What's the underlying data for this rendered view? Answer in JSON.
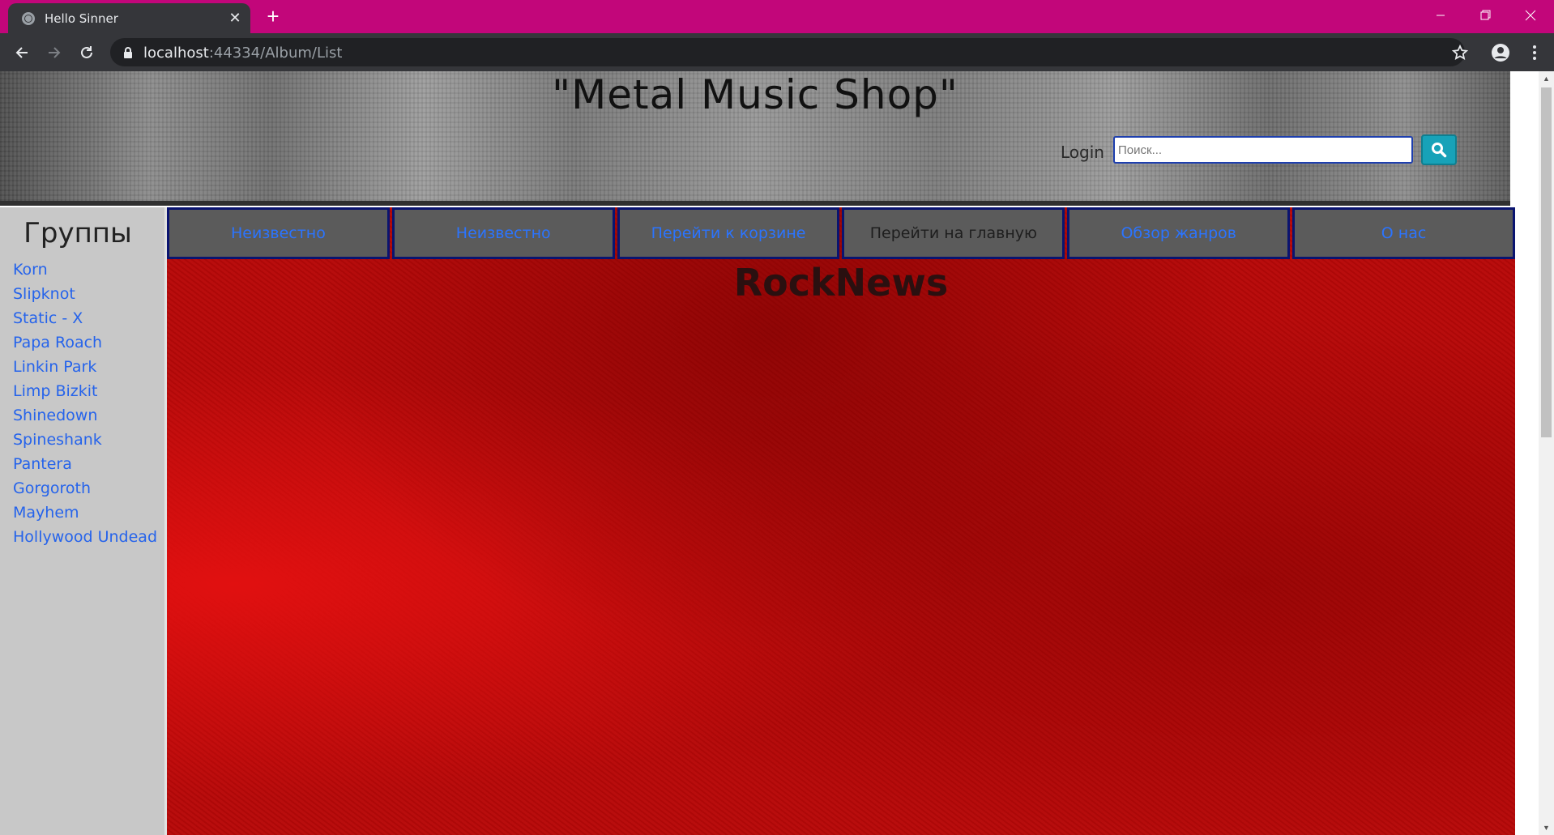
{
  "browser": {
    "accent_color": "#c2067a",
    "tab": {
      "title": "Hello Sinner",
      "favicon": "globe-icon"
    },
    "url": {
      "host": "localhost",
      "rest": ":44334/Album/List"
    }
  },
  "header": {
    "title": "\"Metal Music Shop\"",
    "login": "Login",
    "search_placeholder": "Поиск..."
  },
  "sidebar": {
    "title": "Группы",
    "bands": [
      "Korn",
      "Slipknot",
      "Static - X",
      "Papa Roach",
      "Linkin Park",
      "Limp Bizkit",
      "Shinedown",
      "Spineshank",
      "Pantera",
      "Gorgoroth",
      "Mayhem",
      "Hollywood Undead"
    ]
  },
  "nav": {
    "items": [
      "Неизвестно",
      "Неизвестно",
      "Перейти к корзине",
      "Перейти на главную",
      "Обзор жанров",
      "О нас"
    ]
  },
  "main": {
    "title": "RockNews"
  }
}
